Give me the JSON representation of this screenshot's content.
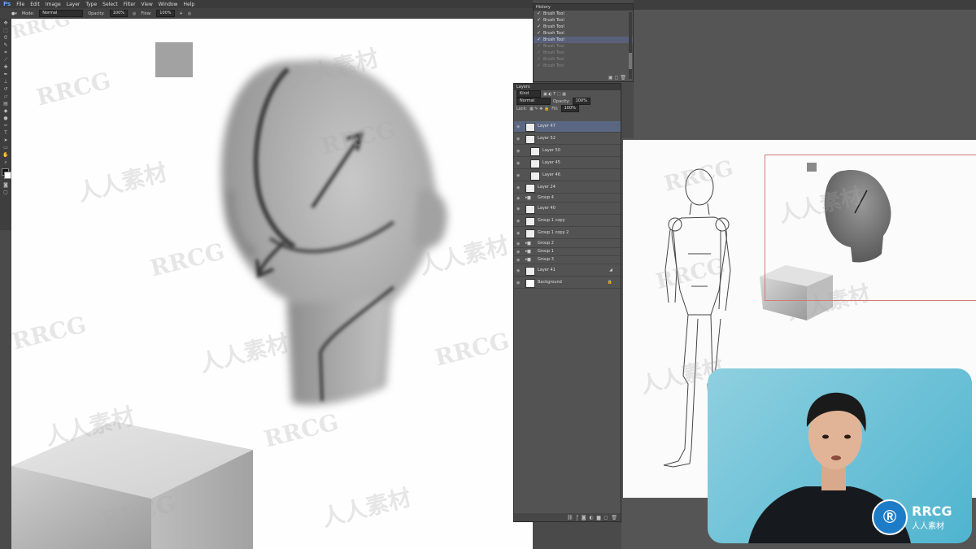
{
  "menubar": {
    "app_icon": "Ps",
    "items": [
      "File",
      "Edit",
      "Image",
      "Layer",
      "Type",
      "Select",
      "Filter",
      "View",
      "Window",
      "Help"
    ]
  },
  "options_bar": {
    "mode_label": "Mode:",
    "mode_value": "Normal",
    "opacity_label": "Opacity:",
    "opacity_value": "100%",
    "flow_label": "Flow:",
    "flow_value": "100%"
  },
  "history": {
    "title": "History",
    "items": [
      {
        "label": "Brush Tool",
        "state": "done"
      },
      {
        "label": "Brush Tool",
        "state": "done"
      },
      {
        "label": "Brush Tool",
        "state": "done"
      },
      {
        "label": "Brush Tool",
        "state": "done"
      },
      {
        "label": "Brush Tool",
        "state": "selected"
      },
      {
        "label": "Brush Tool",
        "state": "undone"
      },
      {
        "label": "Brush Tool",
        "state": "undone"
      },
      {
        "label": "Brush Tool",
        "state": "undone"
      },
      {
        "label": "Brush Tool",
        "state": "undone"
      },
      {
        "label": "Brush Tool",
        "state": "undone"
      }
    ]
  },
  "layers": {
    "title": "Layers",
    "kind_label": "Kind",
    "blend_mode": "Normal",
    "opacity_label": "Opacity:",
    "opacity_value": "100%",
    "lock_label": "Lock:",
    "fill_label": "Fill:",
    "fill_value": "100%",
    "rows": [
      {
        "name": "Layer 47",
        "indent": 0,
        "type": "layer",
        "selected": true
      },
      {
        "name": "Layer 52",
        "indent": 0,
        "type": "layer",
        "selected": false
      },
      {
        "name": "Layer 50",
        "indent": 1,
        "type": "layer",
        "selected": false
      },
      {
        "name": "Layer 45",
        "indent": 1,
        "type": "layer",
        "selected": false
      },
      {
        "name": "Layer 46",
        "indent": 1,
        "type": "layer",
        "selected": false
      },
      {
        "name": "Layer 24",
        "indent": 0,
        "type": "layer",
        "selected": false
      },
      {
        "name": "Group 4",
        "indent": 0,
        "type": "group",
        "selected": false
      },
      {
        "name": "Layer 40",
        "indent": 0,
        "type": "layer",
        "selected": false
      },
      {
        "name": "Group 1 copy",
        "indent": 0,
        "type": "layer",
        "selected": false
      },
      {
        "name": "Group 1 copy 2",
        "indent": 0,
        "type": "layer",
        "selected": false
      },
      {
        "name": "Group 2",
        "indent": 0,
        "type": "group",
        "selected": false
      },
      {
        "name": "Group 1",
        "indent": 0,
        "type": "group",
        "selected": false
      },
      {
        "name": "Group 3",
        "indent": 0,
        "type": "group",
        "selected": false
      },
      {
        "name": "Layer 41",
        "indent": 0,
        "type": "layer",
        "selected": false
      },
      {
        "name": "Background",
        "indent": 0,
        "type": "background",
        "selected": false
      }
    ]
  },
  "watermark": {
    "latin": "RRCG",
    "cjk": "人人素材"
  },
  "logo": {
    "latin": "RRCG",
    "cjk": "人人素材"
  },
  "colors": {
    "canvas": "#fefefe",
    "panel": "#535353",
    "selected_layer": "#5a6783",
    "webcam_bg": "#6cc3da"
  }
}
